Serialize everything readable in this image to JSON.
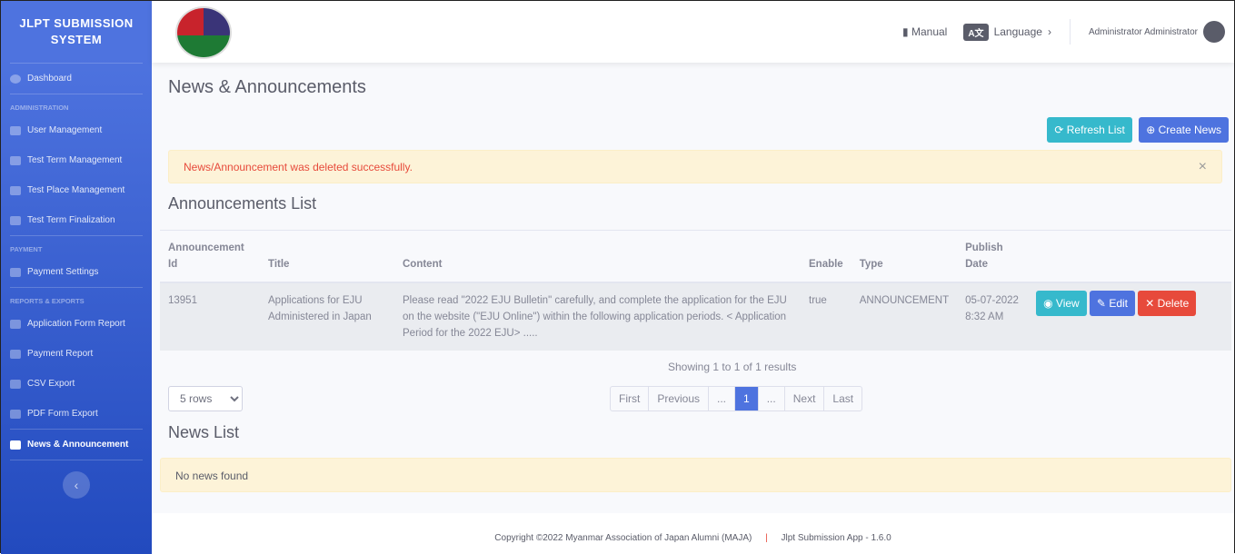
{
  "sidebar": {
    "brand": "JLPT SUBMISSION SYSTEM",
    "dashboard": "Dashboard",
    "admin_heading": "ADMINISTRATION",
    "user_mgmt": "User Management",
    "term_mgmt": "Test Term Management",
    "place_mgmt": "Test Place Management",
    "finalization": "Test Term Finalization",
    "payment_heading": "PAYMENT",
    "payment_settings": "Payment Settings",
    "reports_heading": "REPORTS & EXPORTS",
    "app_report": "Application Form Report",
    "payment_report": "Payment Report",
    "csv_export": "CSV Export",
    "pdf_export": "PDF Form Export",
    "news": "News & Announcement",
    "toggle": "‹"
  },
  "topbar": {
    "manual": "Manual",
    "language_icon": "A文",
    "language": "Language",
    "user": "Administrator Administrator"
  },
  "page": {
    "title": "News & Announcements",
    "refresh": "Refresh List",
    "create": "Create News",
    "alert": "News/Announcement was deleted successfully.",
    "alert_close": "×",
    "announcements_title": "Announcements List",
    "news_title": "News List",
    "no_news": "No news found"
  },
  "table": {
    "headers": {
      "id": "Announcement Id",
      "title": "Title",
      "content": "Content",
      "enable": "Enable",
      "type": "Type",
      "date": "Publish Date"
    },
    "rows": [
      {
        "id": "13951",
        "title": "Applications for EJU Administered in Japan",
        "content": "Please read \"2022 EJU Bulletin\" carefully, and complete the application for the EJU on the website (\"EJU Online\") within the following application periods. < Application Period for the 2022 EJU> .....",
        "enable": "true",
        "type": "ANNOUNCEMENT",
        "date": "05-07-2022 8:32 AM",
        "view": "View",
        "edit": "Edit",
        "delete": "Delete"
      }
    ]
  },
  "pagination": {
    "summary": "Showing 1 to 1 of 1 results",
    "rows": "5 rows",
    "first": "First",
    "previous": "Previous",
    "ellipsis": "...",
    "current": "1",
    "next": "Next",
    "last": "Last"
  },
  "footer": {
    "copyright": "Copyright ©2022 Myanmar Association of Japan Alumni (MAJA)",
    "sep": "|",
    "version": "Jlpt Submission App - 1.6.0"
  },
  "colors": {
    "primary": "#4e73df",
    "info": "#36b9cc",
    "danger": "#e74a3b"
  }
}
